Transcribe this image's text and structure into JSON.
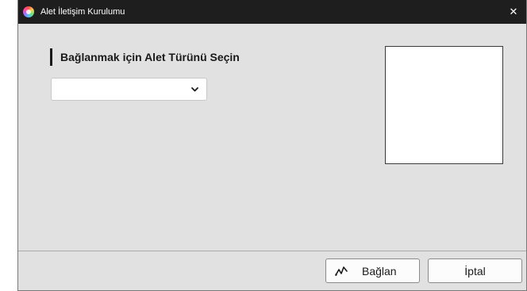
{
  "window": {
    "title": "Alet İletişim Kurulumu",
    "close_symbol": "✕"
  },
  "main": {
    "section_label": "Bağlanmak için Alet Türünü Seçin",
    "instrument_type_select": {
      "value": "",
      "icon": "chevron-down-icon"
    }
  },
  "footer": {
    "connect_label": "Bağlan",
    "connect_icon": "connection-icon",
    "cancel_label": "İptal"
  }
}
